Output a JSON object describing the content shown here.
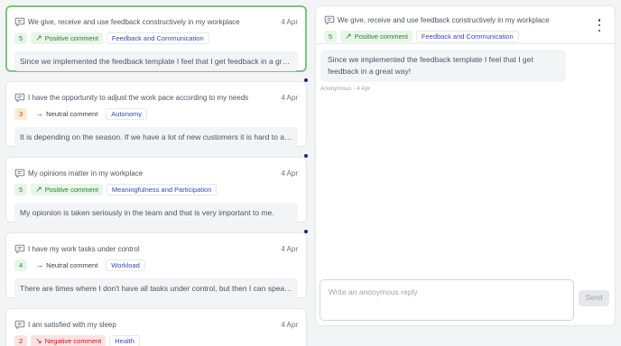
{
  "feed": [
    {
      "question": "We give, receive and use feedback constructively in my workplace",
      "date": "4 Apr",
      "score": "5",
      "score_color": "green",
      "sentiment": "Positive comment",
      "sentiment_type": "pos",
      "category": "Feedback and Communication",
      "preview": "Since we implemented the feedback template I feel that I get feedback in a great way!",
      "selected": true
    },
    {
      "question": "I have the opportunity to adjust the work pace according to my needs",
      "date": "4 Apr",
      "score": "3",
      "score_color": "orange",
      "sentiment": "Neutral comment",
      "sentiment_type": "neu",
      "category": "Autonomy",
      "preview": "It is depending on the season. If we have a lot of new customers it is hard to adjust the pace.",
      "selected": false
    },
    {
      "question": "My opinions matter in my workplace",
      "date": "4 Apr",
      "score": "5",
      "score_color": "green",
      "sentiment": "Positive comment",
      "sentiment_type": "pos",
      "category": "Meaningfulness and Participation",
      "preview": "My opionion is taken seriously in the team and that is very important to me.",
      "selected": false
    },
    {
      "question": "I have my work tasks under control",
      "date": "4 Apr",
      "score": "4",
      "score_color": "green",
      "sentiment": "Neutral comment",
      "sentiment_type": "neu",
      "category": "Workload",
      "preview": "There are times where I don't have all tasks under control, but then I can speak to my manager.",
      "selected": false
    },
    {
      "question": "I am satisfied with my sleep",
      "date": "4 Apr",
      "score": "2",
      "score_color": "red",
      "sentiment": "Negative comment",
      "sentiment_type": "neg",
      "category": "Health",
      "preview": "",
      "selected": false
    }
  ],
  "detail": {
    "question": "We give, receive and use feedback constructively in my workplace",
    "score": "5",
    "sentiment": "Positive comment",
    "category": "Feedback and Communication",
    "message": "Since we implemented the feedback template I feel that I get feedback in a great way!",
    "meta": "Anonymous · 4 Apr",
    "more_icon": "more-vertical-icon"
  },
  "reply": {
    "placeholder": "Write an anonymous reply",
    "send_label": "Send"
  },
  "colors": {
    "selected_border": "#7cc47f",
    "positive": "#2e7d32",
    "negative": "#b91c1c",
    "category": "#3949ab",
    "unread_dot": "#1e2a5a"
  }
}
